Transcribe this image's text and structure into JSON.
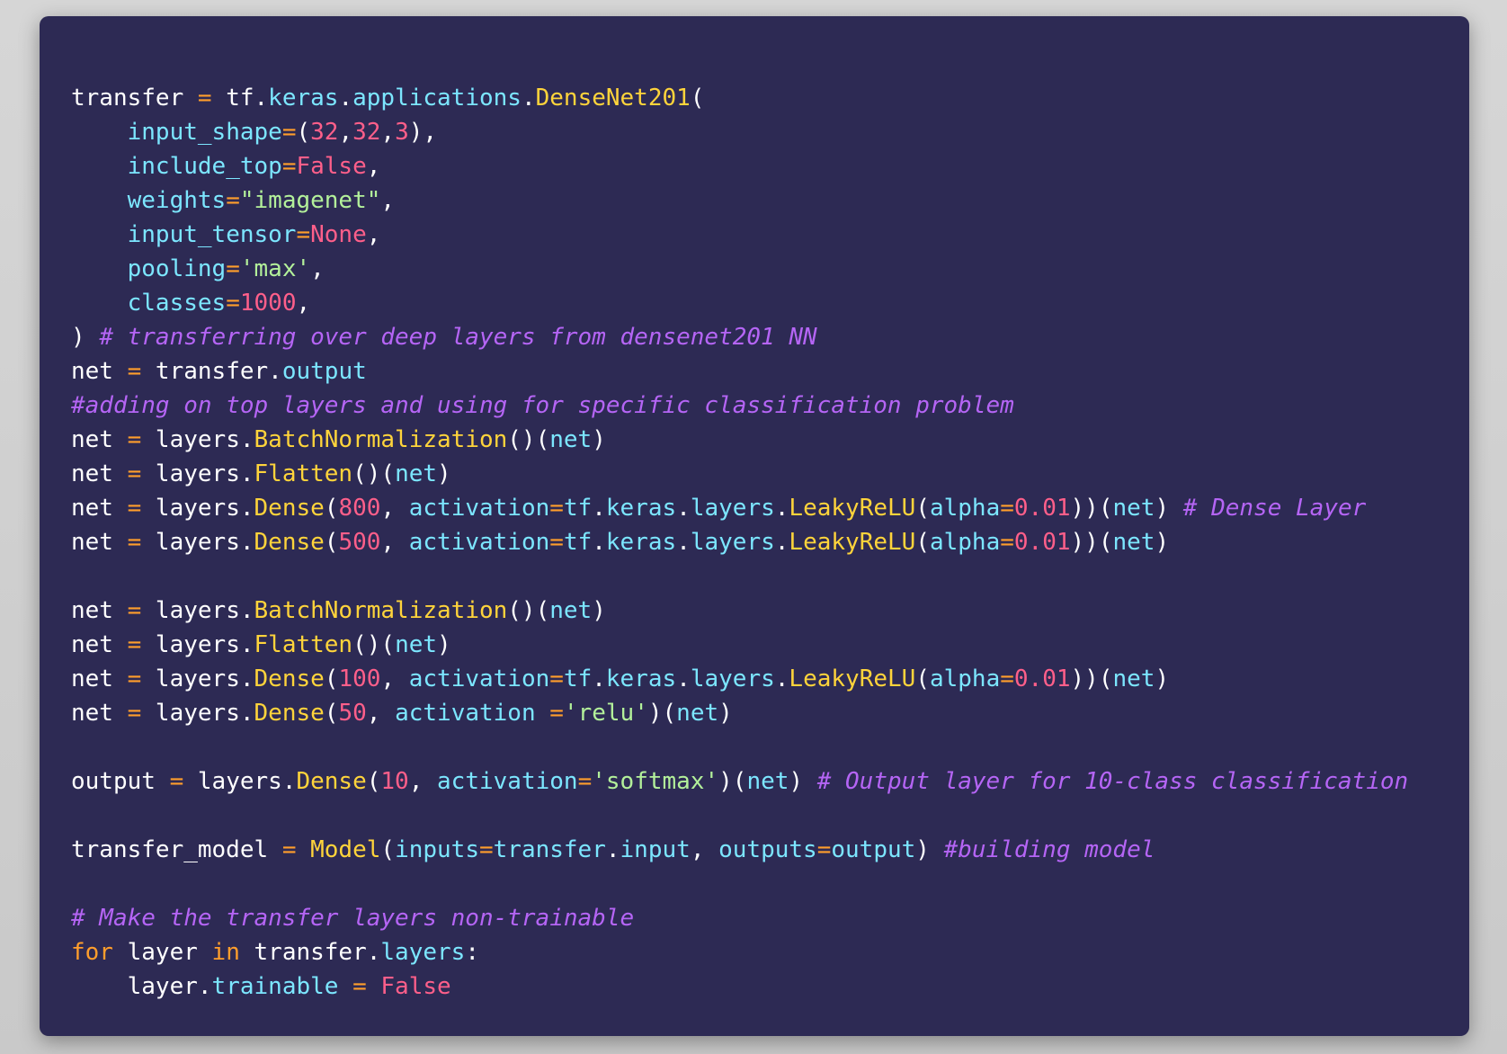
{
  "theme": {
    "background": "#2d2a54",
    "plain": "#ffffff",
    "attribute": "#7ce6ff",
    "function": "#ffd43b",
    "operator": "#ff9e2c",
    "number": "#ff5f8a",
    "string": "#b3f09a",
    "comment": "#b565f5"
  },
  "code": {
    "lines": [
      [
        [
          "plain",
          "transfer "
        ],
        [
          "op",
          "="
        ],
        [
          "plain",
          " tf."
        ],
        [
          "attr",
          "keras"
        ],
        [
          "plain",
          "."
        ],
        [
          "attr",
          "applications"
        ],
        [
          "plain",
          "."
        ],
        [
          "func",
          "DenseNet201"
        ],
        [
          "plain",
          "("
        ]
      ],
      [
        [
          "plain",
          "    "
        ],
        [
          "attr",
          "input_shape"
        ],
        [
          "op",
          "="
        ],
        [
          "plain",
          "("
        ],
        [
          "num",
          "32"
        ],
        [
          "plain",
          ","
        ],
        [
          "num",
          "32"
        ],
        [
          "plain",
          ","
        ],
        [
          "num",
          "3"
        ],
        [
          "plain",
          "),"
        ]
      ],
      [
        [
          "plain",
          "    "
        ],
        [
          "attr",
          "include_top"
        ],
        [
          "op",
          "="
        ],
        [
          "const",
          "False"
        ],
        [
          "plain",
          ","
        ]
      ],
      [
        [
          "plain",
          "    "
        ],
        [
          "attr",
          "weights"
        ],
        [
          "op",
          "="
        ],
        [
          "str",
          "\"imagenet\""
        ],
        [
          "plain",
          ","
        ]
      ],
      [
        [
          "plain",
          "    "
        ],
        [
          "attr",
          "input_tensor"
        ],
        [
          "op",
          "="
        ],
        [
          "const",
          "None"
        ],
        [
          "plain",
          ","
        ]
      ],
      [
        [
          "plain",
          "    "
        ],
        [
          "attr",
          "pooling"
        ],
        [
          "op",
          "="
        ],
        [
          "str",
          "'max'"
        ],
        [
          "plain",
          ","
        ]
      ],
      [
        [
          "plain",
          "    "
        ],
        [
          "attr",
          "classes"
        ],
        [
          "op",
          "="
        ],
        [
          "num",
          "1000"
        ],
        [
          "plain",
          ","
        ]
      ],
      [
        [
          "plain",
          ") "
        ],
        [
          "cmt",
          "# transferring over deep layers from densenet201 NN"
        ]
      ],
      [
        [
          "plain",
          "net "
        ],
        [
          "op",
          "="
        ],
        [
          "plain",
          " transfer."
        ],
        [
          "attr",
          "output"
        ]
      ],
      [
        [
          "cmt",
          "#adding on top layers and using for specific classification problem"
        ]
      ],
      [
        [
          "plain",
          "net "
        ],
        [
          "op",
          "="
        ],
        [
          "plain",
          " layers."
        ],
        [
          "func",
          "BatchNormalization"
        ],
        [
          "plain",
          "()("
        ],
        [
          "attr",
          "net"
        ],
        [
          "plain",
          ")"
        ]
      ],
      [
        [
          "plain",
          "net "
        ],
        [
          "op",
          "="
        ],
        [
          "plain",
          " layers."
        ],
        [
          "func",
          "Flatten"
        ],
        [
          "plain",
          "()("
        ],
        [
          "attr",
          "net"
        ],
        [
          "plain",
          ")"
        ]
      ],
      [
        [
          "plain",
          "net "
        ],
        [
          "op",
          "="
        ],
        [
          "plain",
          " layers."
        ],
        [
          "func",
          "Dense"
        ],
        [
          "plain",
          "("
        ],
        [
          "num",
          "800"
        ],
        [
          "plain",
          ", "
        ],
        [
          "attr",
          "activation"
        ],
        [
          "op",
          "="
        ],
        [
          "attr",
          "tf"
        ],
        [
          "plain",
          "."
        ],
        [
          "attr",
          "keras"
        ],
        [
          "plain",
          "."
        ],
        [
          "attr",
          "layers"
        ],
        [
          "plain",
          "."
        ],
        [
          "func",
          "LeakyReLU"
        ],
        [
          "plain",
          "("
        ],
        [
          "attr",
          "alpha"
        ],
        [
          "op",
          "="
        ],
        [
          "num",
          "0.01"
        ],
        [
          "plain",
          "))("
        ],
        [
          "attr",
          "net"
        ],
        [
          "plain",
          ") "
        ],
        [
          "cmt",
          "# Dense Layer"
        ]
      ],
      [
        [
          "plain",
          "net "
        ],
        [
          "op",
          "="
        ],
        [
          "plain",
          " layers."
        ],
        [
          "func",
          "Dense"
        ],
        [
          "plain",
          "("
        ],
        [
          "num",
          "500"
        ],
        [
          "plain",
          ", "
        ],
        [
          "attr",
          "activation"
        ],
        [
          "op",
          "="
        ],
        [
          "attr",
          "tf"
        ],
        [
          "plain",
          "."
        ],
        [
          "attr",
          "keras"
        ],
        [
          "plain",
          "."
        ],
        [
          "attr",
          "layers"
        ],
        [
          "plain",
          "."
        ],
        [
          "func",
          "LeakyReLU"
        ],
        [
          "plain",
          "("
        ],
        [
          "attr",
          "alpha"
        ],
        [
          "op",
          "="
        ],
        [
          "num",
          "0.01"
        ],
        [
          "plain",
          "))("
        ],
        [
          "attr",
          "net"
        ],
        [
          "plain",
          ")"
        ]
      ],
      [],
      [
        [
          "plain",
          "net "
        ],
        [
          "op",
          "="
        ],
        [
          "plain",
          " layers."
        ],
        [
          "func",
          "BatchNormalization"
        ],
        [
          "plain",
          "()("
        ],
        [
          "attr",
          "net"
        ],
        [
          "plain",
          ")"
        ]
      ],
      [
        [
          "plain",
          "net "
        ],
        [
          "op",
          "="
        ],
        [
          "plain",
          " layers."
        ],
        [
          "func",
          "Flatten"
        ],
        [
          "plain",
          "()("
        ],
        [
          "attr",
          "net"
        ],
        [
          "plain",
          ")"
        ]
      ],
      [
        [
          "plain",
          "net "
        ],
        [
          "op",
          "="
        ],
        [
          "plain",
          " layers."
        ],
        [
          "func",
          "Dense"
        ],
        [
          "plain",
          "("
        ],
        [
          "num",
          "100"
        ],
        [
          "plain",
          ", "
        ],
        [
          "attr",
          "activation"
        ],
        [
          "op",
          "="
        ],
        [
          "attr",
          "tf"
        ],
        [
          "plain",
          "."
        ],
        [
          "attr",
          "keras"
        ],
        [
          "plain",
          "."
        ],
        [
          "attr",
          "layers"
        ],
        [
          "plain",
          "."
        ],
        [
          "func",
          "LeakyReLU"
        ],
        [
          "plain",
          "("
        ],
        [
          "attr",
          "alpha"
        ],
        [
          "op",
          "="
        ],
        [
          "num",
          "0.01"
        ],
        [
          "plain",
          "))("
        ],
        [
          "attr",
          "net"
        ],
        [
          "plain",
          ")"
        ]
      ],
      [
        [
          "plain",
          "net "
        ],
        [
          "op",
          "="
        ],
        [
          "plain",
          " layers."
        ],
        [
          "func",
          "Dense"
        ],
        [
          "plain",
          "("
        ],
        [
          "num",
          "50"
        ],
        [
          "plain",
          ", "
        ],
        [
          "attr",
          "activation"
        ],
        [
          "plain",
          " "
        ],
        [
          "op",
          "="
        ],
        [
          "str",
          "'relu'"
        ],
        [
          "plain",
          ")("
        ],
        [
          "attr",
          "net"
        ],
        [
          "plain",
          ")"
        ]
      ],
      [],
      [
        [
          "plain",
          "output "
        ],
        [
          "op",
          "="
        ],
        [
          "plain",
          " layers."
        ],
        [
          "func",
          "Dense"
        ],
        [
          "plain",
          "("
        ],
        [
          "num",
          "10"
        ],
        [
          "plain",
          ", "
        ],
        [
          "attr",
          "activation"
        ],
        [
          "op",
          "="
        ],
        [
          "str",
          "'softmax'"
        ],
        [
          "plain",
          ")("
        ],
        [
          "attr",
          "net"
        ],
        [
          "plain",
          ") "
        ],
        [
          "cmt",
          "# Output layer for 10-class classification"
        ]
      ],
      [],
      [
        [
          "plain",
          "transfer_model "
        ],
        [
          "op",
          "="
        ],
        [
          "plain",
          " "
        ],
        [
          "func",
          "Model"
        ],
        [
          "plain",
          "("
        ],
        [
          "attr",
          "inputs"
        ],
        [
          "op",
          "="
        ],
        [
          "attr",
          "transfer"
        ],
        [
          "plain",
          "."
        ],
        [
          "attr",
          "input"
        ],
        [
          "plain",
          ", "
        ],
        [
          "attr",
          "outputs"
        ],
        [
          "op",
          "="
        ],
        [
          "attr",
          "output"
        ],
        [
          "plain",
          ") "
        ],
        [
          "cmt",
          "#building model"
        ]
      ],
      [],
      [
        [
          "cmt",
          "# Make the transfer layers non-trainable"
        ]
      ],
      [
        [
          "kw",
          "for"
        ],
        [
          "plain",
          " layer "
        ],
        [
          "kw",
          "in"
        ],
        [
          "plain",
          " transfer."
        ],
        [
          "attr",
          "layers"
        ],
        [
          "plain",
          ":"
        ]
      ],
      [
        [
          "plain",
          "    layer."
        ],
        [
          "attr",
          "trainable"
        ],
        [
          "plain",
          " "
        ],
        [
          "op",
          "="
        ],
        [
          "plain",
          " "
        ],
        [
          "const",
          "False"
        ]
      ]
    ]
  }
}
